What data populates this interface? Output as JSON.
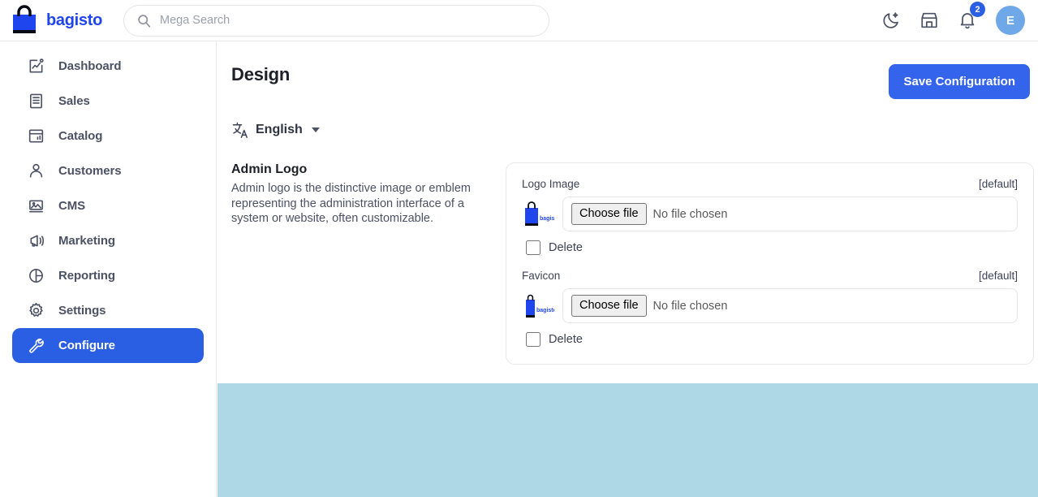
{
  "header": {
    "brand_name": "bagisto",
    "brand_icon": "shopping-bag-icon",
    "search": {
      "placeholder": "Mega Search",
      "value": "",
      "icon": "search-icon"
    },
    "icons": [
      {
        "name": "dark-mode-icon",
        "label": "Dark mode"
      },
      {
        "name": "storefront-icon",
        "label": "Visit shop"
      },
      {
        "name": "notification-bell-icon",
        "label": "Notifications"
      }
    ],
    "notification_count": "2",
    "avatar_initial": "E",
    "badge_color": "#2b5fe3",
    "avatar_color": "#6ea8e8"
  },
  "sidebar": {
    "items": [
      {
        "label": "Dashboard",
        "icon": "dashboard-chart-icon",
        "active": false
      },
      {
        "label": "Sales",
        "icon": "document-lines-icon",
        "active": false
      },
      {
        "label": "Catalog",
        "icon": "catalog-window-icon",
        "active": false
      },
      {
        "label": "Customers",
        "icon": "user-person-icon",
        "active": false
      },
      {
        "label": "CMS",
        "icon": "image-picture-icon",
        "active": false
      },
      {
        "label": "Marketing",
        "icon": "megaphone-icon",
        "active": false
      },
      {
        "label": "Reporting",
        "icon": "pie-chart-icon",
        "active": false
      },
      {
        "label": "Settings",
        "icon": "gear-icon",
        "active": false
      },
      {
        "label": "Configure",
        "icon": "wrench-icon",
        "active": true
      }
    ],
    "active_color": "#2b5fe3"
  },
  "main": {
    "page_title": "Design",
    "save_label": "Save Configuration",
    "save_color": "#3463ec",
    "language": {
      "label": "English",
      "icon": "translate-icon"
    },
    "section": {
      "title": "Admin Logo",
      "description": "Admin logo is the distinctive image or emblem representing the administration interface of a system or website, often customizable.",
      "fields": [
        {
          "label": "Logo Image",
          "scope": "[default]",
          "thumbnail": "bagisto-logo-thumbnail",
          "choose_label": "Choose file",
          "file_name": "No file chosen",
          "delete_label": "Delete",
          "delete_checked": false
        },
        {
          "label": "Favicon",
          "scope": "[default]",
          "thumbnail": "bagisto-favicon-thumbnail",
          "choose_label": "Choose file",
          "file_name": "No file chosen",
          "delete_label": "Delete",
          "delete_checked": false
        }
      ]
    }
  },
  "bottom_panel": {
    "color": "#aed8e6"
  }
}
